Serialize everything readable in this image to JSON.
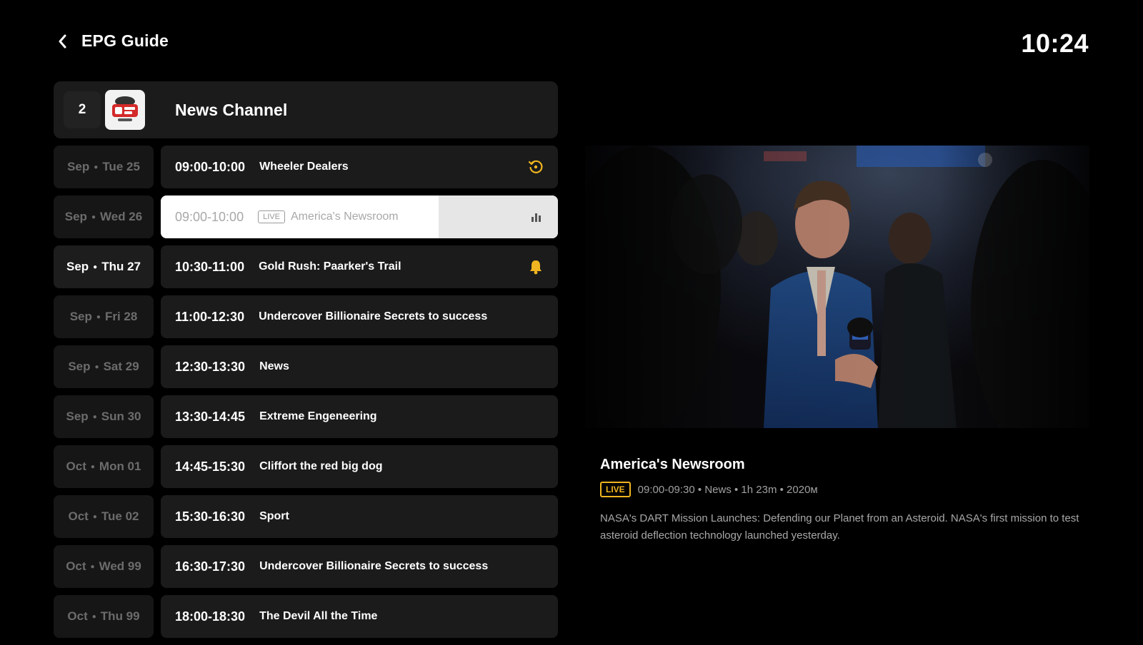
{
  "header": {
    "back_icon": "chevron-left-icon",
    "title": "EPG Guide",
    "clock": "10:24"
  },
  "channel": {
    "number": "2",
    "logo_icon": "news-channel-logo",
    "name": "News Channel"
  },
  "schedule": [
    {
      "month": "Sep",
      "day": "Tue 25",
      "time": "09:00-10:00",
      "title": "Wheeler Dealers",
      "icon": "replay-icon",
      "icon_color": "#f0b520",
      "live": false,
      "date_active": false,
      "selected": false
    },
    {
      "month": "Sep",
      "day": "Wed 26",
      "time": "09:00-10:00",
      "title": "America's Newsroom",
      "icon": "equalizer-icon",
      "icon_color": "#555555",
      "live": true,
      "live_label": "LIVE",
      "date_active": false,
      "selected": true,
      "progress": 0.7
    },
    {
      "month": "Sep",
      "day": "Thu 27",
      "time": "10:30-11:00",
      "title": "Gold Rush: Paarker's Trail",
      "icon": "bell-icon",
      "icon_color": "#f0b520",
      "live": false,
      "date_active": true,
      "selected": false
    },
    {
      "month": "Sep",
      "day": "Fri 28",
      "time": "11:00-12:30",
      "title": "Undercover Billionaire Secrets to success",
      "icon": "",
      "live": false,
      "date_active": false,
      "selected": false
    },
    {
      "month": "Sep",
      "day": "Sat 29",
      "time": "12:30-13:30",
      "title": "News",
      "icon": "",
      "live": false,
      "date_active": false,
      "selected": false
    },
    {
      "month": "Sep",
      "day": "Sun 30",
      "time": "13:30-14:45",
      "title": "Extreme Engeneering",
      "icon": "",
      "live": false,
      "date_active": false,
      "selected": false
    },
    {
      "month": "Oct",
      "day": "Mon 01",
      "time": "14:45-15:30",
      "title": "Cliffort the red big dog",
      "icon": "",
      "live": false,
      "date_active": false,
      "selected": false
    },
    {
      "month": "Oct",
      "day": "Tue 02",
      "time": "15:30-16:30",
      "title": "Sport",
      "icon": "",
      "live": false,
      "date_active": false,
      "selected": false
    },
    {
      "month": "Oct",
      "day": "Wed 99",
      "time": "16:30-17:30",
      "title": "Undercover Billionaire Secrets to success",
      "icon": "",
      "live": false,
      "date_active": false,
      "selected": false
    },
    {
      "month": "Oct",
      "day": "Thu 99",
      "time": "18:00-18:30",
      "title": "The Devil All the Time",
      "icon": "",
      "live": false,
      "date_active": false,
      "selected": false
    }
  ],
  "details": {
    "title": "America's Newsroom",
    "live_label": "LIVE",
    "meta": "09:00-09:30 • News • 1h 23m • 2020м",
    "description": "NASA's DART Mission Launches: Defending our Planet from an Asteroid. NASA's first mission to test asteroid deflection technology launched yesterday.",
    "preview_image": "news-reporter-crowd-photo"
  },
  "colors": {
    "accent": "#f0b520",
    "background": "#000000",
    "card": "#1b1b1b"
  }
}
